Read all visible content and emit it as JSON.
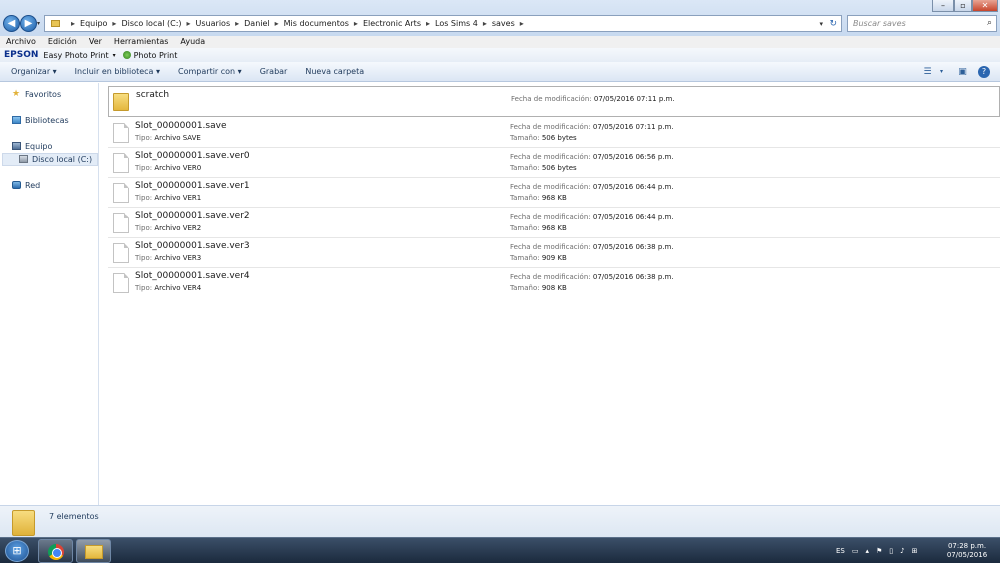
{
  "window": {
    "controls": {
      "minimize": "–",
      "maximize": "▫",
      "close": "✕"
    }
  },
  "address_bar": {
    "crumbs": [
      "Equipo",
      "Disco local (C:)",
      "Usuarios",
      "Daniel",
      "Mis documentos",
      "Electronic Arts",
      "Los Sims 4",
      "saves"
    ],
    "search_placeholder": "Buscar saves"
  },
  "menu": [
    "Archivo",
    "Edición",
    "Ver",
    "Herramientas",
    "Ayuda"
  ],
  "epson": {
    "logo": "EPSON",
    "app": "Easy Photo Print",
    "photo": "Photo Print"
  },
  "commands": [
    "Organizar ▾",
    "Incluir en biblioteca ▾",
    "Compartir con ▾",
    "Grabar",
    "Nueva carpeta"
  ],
  "sidebar": {
    "favorites": "Favoritos",
    "libraries": "Bibliotecas",
    "computer": "Equipo",
    "local_disk": "Disco local (C:)",
    "network": "Red"
  },
  "labels": {
    "modified": "Fecha de modificación:",
    "type": "Tipo:",
    "size": "Tamaño:"
  },
  "files": [
    {
      "name": "scratch",
      "kind": "folder",
      "modified": "07/05/2016 07:11 p.m."
    },
    {
      "name": "Slot_00000001.save",
      "type": "Archivo SAVE",
      "modified": "07/05/2016 07:11 p.m.",
      "size": "506 bytes"
    },
    {
      "name": "Slot_00000001.save.ver0",
      "type": "Archivo VER0",
      "modified": "07/05/2016 06:56 p.m.",
      "size": "506 bytes"
    },
    {
      "name": "Slot_00000001.save.ver1",
      "type": "Archivo VER1",
      "modified": "07/05/2016 06:44 p.m.",
      "size": "968 KB"
    },
    {
      "name": "Slot_00000001.save.ver2",
      "type": "Archivo VER2",
      "modified": "07/05/2016 06:44 p.m.",
      "size": "968 KB"
    },
    {
      "name": "Slot_00000001.save.ver3",
      "type": "Archivo VER3",
      "modified": "07/05/2016 06:38 p.m.",
      "size": "909 KB"
    },
    {
      "name": "Slot_00000001.save.ver4",
      "type": "Archivo VER4",
      "modified": "07/05/2016 06:38 p.m.",
      "size": "908 KB"
    }
  ],
  "status": {
    "count": "7 elementos"
  },
  "taskbar": {
    "lang": "ES",
    "time": "07:28 p.m.",
    "date": "07/05/2016"
  }
}
